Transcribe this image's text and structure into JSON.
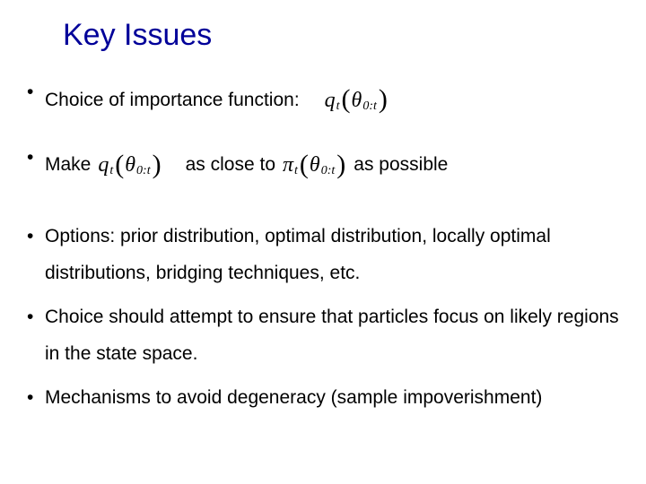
{
  "title": "Key Issues",
  "bullets": {
    "b1": "Choice of importance function:",
    "b2_pre": "Make",
    "b2_mid": "as close to",
    "b2_post": "as possible",
    "b3": "Options: prior distribution, optimal distribution, locally optimal distributions, bridging techniques, etc.",
    "b4": "Choice should attempt to ensure that particles focus on likely regions in the state space.",
    "b5": "Mechanisms to avoid degeneracy (sample impoverishment)"
  },
  "math": {
    "q_sym": "q",
    "pi_sym": "π",
    "sub_t": "t",
    "theta": "θ",
    "sub_range": "0:t",
    "lparen": "(",
    "rparen": ")"
  }
}
